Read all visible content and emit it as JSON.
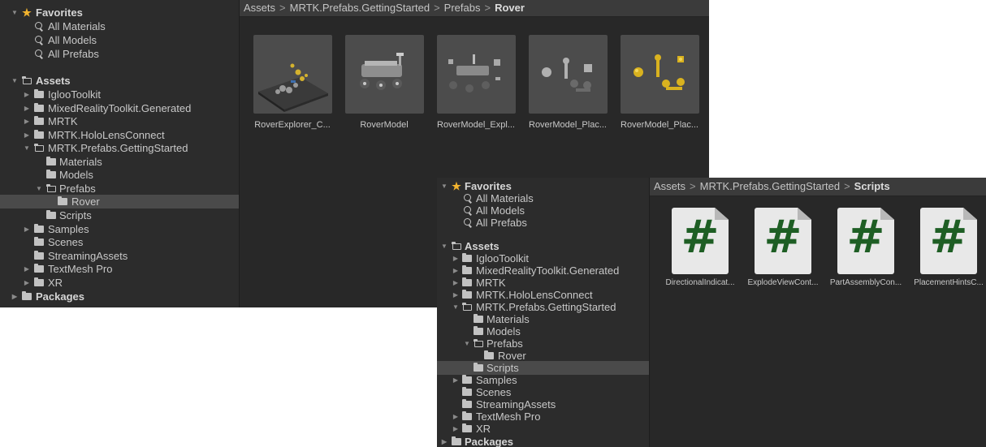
{
  "panel1": {
    "breadcrumb": [
      "Assets",
      "MRTK.Prefabs.GettingStarted",
      "Prefabs"
    ],
    "breadcrumb_current": "Rover",
    "favorites": {
      "label": "Favorites",
      "items": [
        "All Materials",
        "All Models",
        "All Prefabs"
      ]
    },
    "assets_label": "Assets",
    "tree": [
      {
        "label": "IglooToolkit"
      },
      {
        "label": "MixedRealityToolkit.Generated"
      },
      {
        "label": "MRTK"
      },
      {
        "label": "MRTK.HoloLensConnect"
      },
      {
        "label": "MRTK.Prefabs.GettingStarted"
      },
      {
        "label": "Materials"
      },
      {
        "label": "Models"
      },
      {
        "label": "Prefabs"
      },
      {
        "label": "Rover"
      },
      {
        "label": "Scripts"
      },
      {
        "label": "Samples"
      },
      {
        "label": "Scenes"
      },
      {
        "label": "StreamingAssets"
      },
      {
        "label": "TextMesh Pro"
      },
      {
        "label": "XR"
      }
    ],
    "packages_label": "Packages",
    "assets": [
      "RoverExplorer_C...",
      "RoverModel",
      "RoverModel_Expl...",
      "RoverModel_Plac...",
      "RoverModel_Plac..."
    ]
  },
  "panel2": {
    "breadcrumb": [
      "Assets",
      "MRTK.Prefabs.GettingStarted"
    ],
    "breadcrumb_current": "Scripts",
    "favorites": {
      "label": "Favorites",
      "items": [
        "All Materials",
        "All Models",
        "All Prefabs"
      ]
    },
    "assets_label": "Assets",
    "tree": [
      {
        "label": "IglooToolkit"
      },
      {
        "label": "MixedRealityToolkit.Generated"
      },
      {
        "label": "MRTK"
      },
      {
        "label": "MRTK.HoloLensConnect"
      },
      {
        "label": "MRTK.Prefabs.GettingStarted"
      },
      {
        "label": "Materials"
      },
      {
        "label": "Models"
      },
      {
        "label": "Prefabs"
      },
      {
        "label": "Rover"
      },
      {
        "label": "Scripts"
      },
      {
        "label": "Samples"
      },
      {
        "label": "Scenes"
      },
      {
        "label": "StreamingAssets"
      },
      {
        "label": "TextMesh Pro"
      },
      {
        "label": "XR"
      }
    ],
    "packages_label": "Packages",
    "scripts": [
      "DirectionalIndicat...",
      "ExplodeViewCont...",
      "PartAssemblyCon...",
      "PlacementHintsC..."
    ],
    "script_icon_glyph": "#"
  },
  "colors": {
    "panel_bg": "#282828",
    "tree_bg": "#2c2c2c",
    "breadcrumb_bg": "#3b3b3b",
    "selection": "#4a4a4a",
    "star": "#f2b32e",
    "csharp_icon": "#1e5e24"
  }
}
